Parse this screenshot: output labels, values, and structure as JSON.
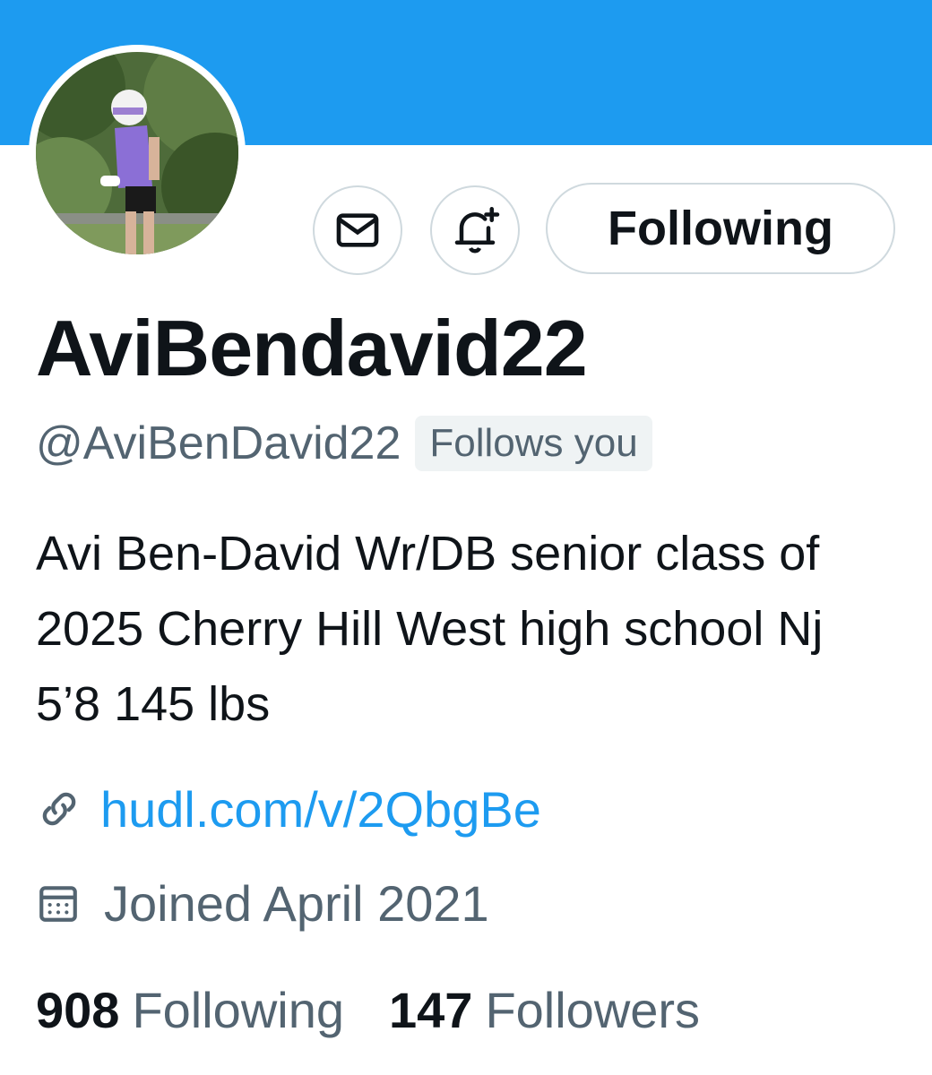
{
  "profile": {
    "display_name": "AviBendavid22",
    "handle": "@AviBenDavid22",
    "follows_you_badge": "Follows you",
    "bio": "Avi Ben-David Wr/DB senior class of 2025 Cherry Hill West high school Nj 5’8 145 lbs",
    "link": "hudl.com/v/2QbgBe",
    "joined": "Joined April 2021"
  },
  "actions": {
    "following_button": "Following",
    "message_icon": "mail-icon",
    "notify_icon": "bell-plus-icon"
  },
  "stats": {
    "following_count": "908",
    "following_label": "Following",
    "followers_count": "147",
    "followers_label": "Followers"
  },
  "colors": {
    "banner": "#1d9bf0",
    "link": "#1d9bf0",
    "secondary_text": "#536471",
    "primary_text": "#0f1419",
    "border": "#cfd9de"
  }
}
